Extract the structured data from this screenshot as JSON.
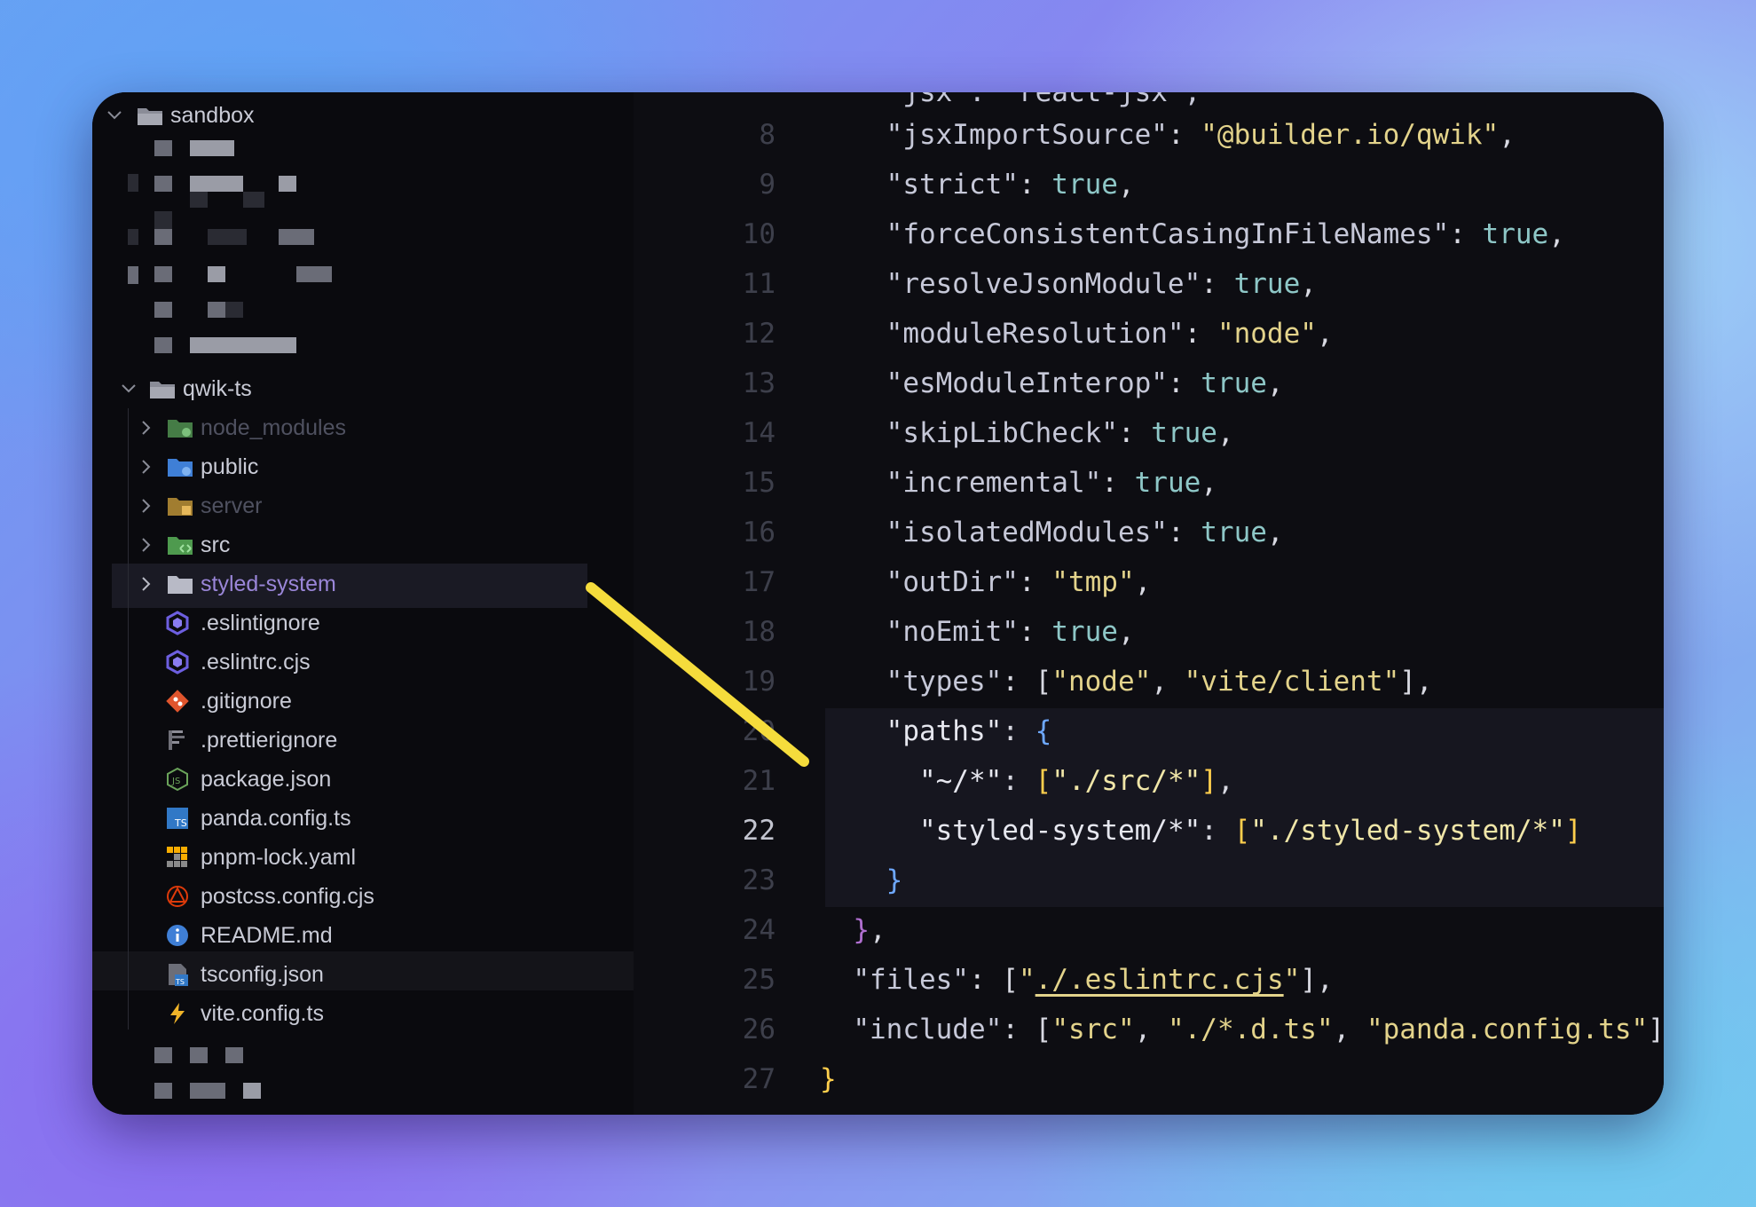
{
  "explorer": {
    "root_folder": "sandbox",
    "project_folder": "qwik-ts",
    "items": [
      {
        "label": "node_modules",
        "type": "folder",
        "icon": "node-folder-icon",
        "dim": true
      },
      {
        "label": "public",
        "type": "folder",
        "icon": "public-folder-icon",
        "dim": false
      },
      {
        "label": "server",
        "type": "folder",
        "icon": "server-folder-icon",
        "dim": true
      },
      {
        "label": "src",
        "type": "folder",
        "icon": "src-folder-icon",
        "dim": false
      },
      {
        "label": "styled-system",
        "type": "folder",
        "icon": "folder-icon",
        "dim": false,
        "selected": true
      },
      {
        "label": ".eslintignore",
        "type": "file",
        "icon": "eslint-icon"
      },
      {
        "label": ".eslintrc.cjs",
        "type": "file",
        "icon": "eslint-icon"
      },
      {
        "label": ".gitignore",
        "type": "file",
        "icon": "git-icon"
      },
      {
        "label": ".prettierignore",
        "type": "file",
        "icon": "prettier-icon"
      },
      {
        "label": "package.json",
        "type": "file",
        "icon": "nodejs-icon"
      },
      {
        "label": "panda.config.ts",
        "type": "file",
        "icon": "typescript-icon"
      },
      {
        "label": "pnpm-lock.yaml",
        "type": "file",
        "icon": "pnpm-icon"
      },
      {
        "label": "postcss.config.cjs",
        "type": "file",
        "icon": "postcss-icon"
      },
      {
        "label": "README.md",
        "type": "file",
        "icon": "info-icon"
      },
      {
        "label": "tsconfig.json",
        "type": "file",
        "icon": "tsconfig-icon",
        "active": true
      },
      {
        "label": "vite.config.ts",
        "type": "file",
        "icon": "vite-icon"
      }
    ]
  },
  "editor": {
    "active_line": "22",
    "lines": [
      {
        "n": "8",
        "text": "    \"jsxImportSource\": \"@builder.io/qwik\","
      },
      {
        "n": "9",
        "text": "    \"strict\": true,"
      },
      {
        "n": "10",
        "text": "    \"forceConsistentCasingInFileNames\": true,"
      },
      {
        "n": "11",
        "text": "    \"resolveJsonModule\": true,"
      },
      {
        "n": "12",
        "text": "    \"moduleResolution\": \"node\","
      },
      {
        "n": "13",
        "text": "    \"esModuleInterop\": true,"
      },
      {
        "n": "14",
        "text": "    \"skipLibCheck\": true,"
      },
      {
        "n": "15",
        "text": "    \"incremental\": true,"
      },
      {
        "n": "16",
        "text": "    \"isolatedModules\": true,"
      },
      {
        "n": "17",
        "text": "    \"outDir\": \"tmp\","
      },
      {
        "n": "18",
        "text": "    \"noEmit\": true,"
      },
      {
        "n": "19",
        "text": "    \"types\": [\"node\", \"vite/client\"],"
      },
      {
        "n": "20",
        "text": "    \"paths\": {"
      },
      {
        "n": "21",
        "text": "      \"~/*\": [\"./src/*\"],"
      },
      {
        "n": "22",
        "text": "      \"styled-system/*\": [\"./styled-system/*\"]"
      },
      {
        "n": "23",
        "text": "    }"
      },
      {
        "n": "24",
        "text": "  },"
      },
      {
        "n": "25",
        "text": "  \"files\": [\"./.eslintrc.cjs\"],"
      },
      {
        "n": "26",
        "text": "  \"include\": [\"src\", \"./*.d.ts\", \"panda.config.ts\"]"
      },
      {
        "n": "27",
        "text": "}"
      }
    ]
  },
  "colors": {
    "annotation_arrow": "#f5dc3c",
    "keyword_bool": "#8ec7c7",
    "string": "#e3d38b",
    "brace": "#6ea8ff"
  }
}
